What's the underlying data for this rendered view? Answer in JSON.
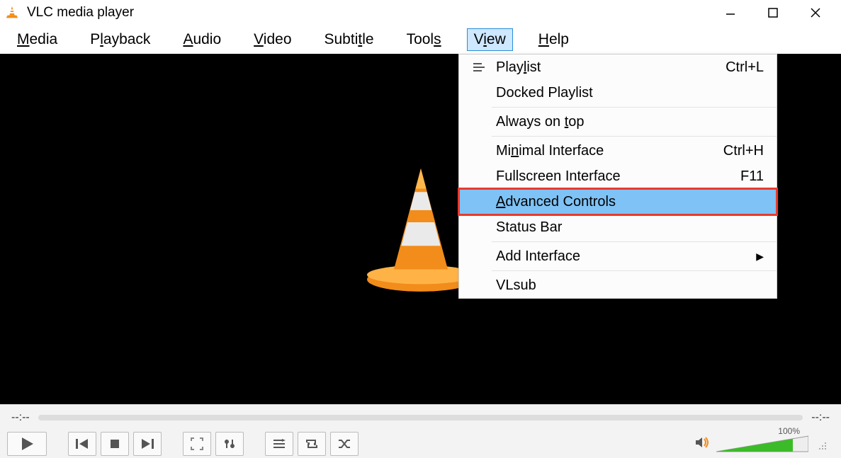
{
  "titlebar": {
    "title": "VLC media player"
  },
  "menubar": {
    "items": [
      {
        "label": "Media",
        "ul": "M"
      },
      {
        "label": "Playback",
        "ul": "l"
      },
      {
        "label": "Audio",
        "ul": "A"
      },
      {
        "label": "Video",
        "ul": "V"
      },
      {
        "label": "Subtitle",
        "ul": "t"
      },
      {
        "label": "Tools",
        "ul": "s"
      },
      {
        "label": "View",
        "ul": "i",
        "active": true
      },
      {
        "label": "Help",
        "ul": "H"
      }
    ]
  },
  "dropdown": {
    "items": [
      {
        "icon": "playlist-icon",
        "label": "Playlist",
        "ul": "l",
        "accel": "Ctrl+L"
      },
      {
        "label": "Docked Playlist"
      },
      {
        "sep": true
      },
      {
        "label": "Always on top",
        "ul": "t"
      },
      {
        "sep": true
      },
      {
        "label": "Minimal Interface",
        "ul": "n",
        "accel": "Ctrl+H"
      },
      {
        "label": "Fullscreen Interface",
        "accel": "F11"
      },
      {
        "label": "Advanced Controls",
        "ul": "A",
        "highlight": true
      },
      {
        "label": "Status Bar"
      },
      {
        "sep": true
      },
      {
        "label": "Add Interface",
        "submenu": true
      },
      {
        "sep": true
      },
      {
        "label": "VLsub"
      }
    ]
  },
  "seek": {
    "elapsed": "--:--",
    "total": "--:--"
  },
  "volume": {
    "label": "100%"
  }
}
